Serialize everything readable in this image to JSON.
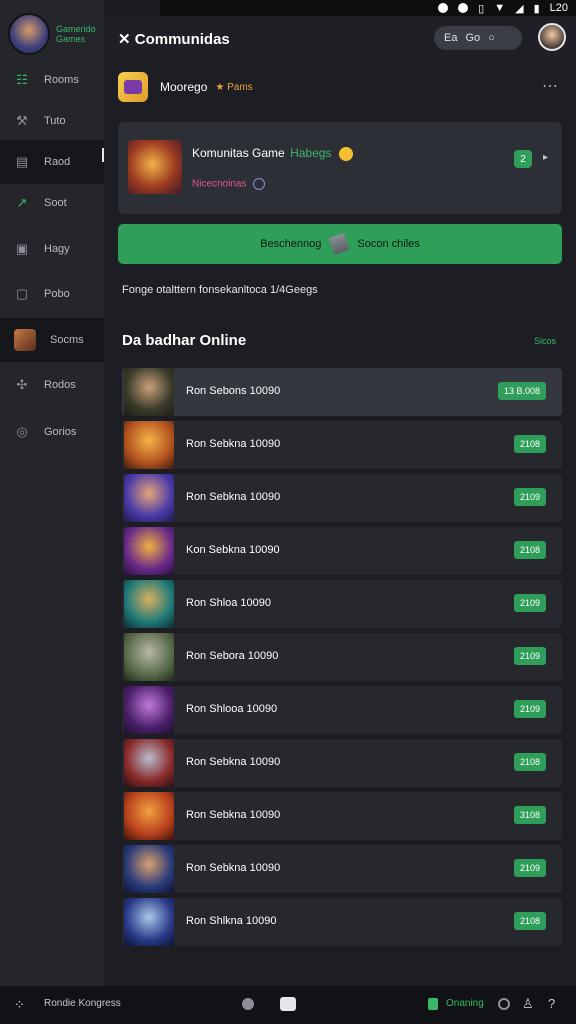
{
  "status_bar": {
    "time": "L20"
  },
  "brand": {
    "line1": "Gamerido",
    "line2": "Games"
  },
  "sidebar": {
    "items": [
      {
        "label": "Rooms",
        "icon": "grid-icon"
      },
      {
        "label": "Tuto",
        "icon": "wrench-icon"
      },
      {
        "label": "Raod",
        "icon": "folder-icon"
      },
      {
        "label": "Soot",
        "icon": "trend-icon"
      },
      {
        "label": "Hagy",
        "icon": "image-icon"
      },
      {
        "label": "Pobo",
        "icon": "box-icon"
      },
      {
        "label": "Socms",
        "icon": "avatar-badge"
      },
      {
        "label": "Rodos",
        "icon": "puzzle-icon"
      },
      {
        "label": "Gorios",
        "icon": "settings-icon"
      }
    ]
  },
  "header": {
    "title": "Communidas",
    "action1": "Ea",
    "action2": "Go"
  },
  "group": {
    "name": "Moorego",
    "tag": "Pams"
  },
  "community": {
    "title": "Komunitas Game",
    "title_suffix": "Habegs",
    "subtitle": "Nicecnoinas",
    "badge": "2"
  },
  "join": {
    "left": "Beschennog",
    "right": "Socon chiles"
  },
  "info": "Fonge otalttern fonsekanltoca 1/4Geegs",
  "online": {
    "title": "Da badhar Online",
    "link": "Sicos",
    "players": [
      {
        "label": "Ron Sebons 10090",
        "badge": "13 B.008"
      },
      {
        "label": "Ron Sebkna 10090",
        "badge": "2108"
      },
      {
        "label": "Ron Sebkna 10090",
        "badge": "2109"
      },
      {
        "label": "Kon Sebkna 10090",
        "badge": "2108"
      },
      {
        "label": "Ron Shloa 10090",
        "badge": "2109"
      },
      {
        "label": "Ron Sebora 10090",
        "badge": "2109"
      },
      {
        "label": "Ron Shlooa 10090",
        "badge": "2109"
      },
      {
        "label": "Ron Sebkna 10090",
        "badge": "2108"
      },
      {
        "label": "Ron Sebkna 10090",
        "badge": "3108"
      },
      {
        "label": "Ron Sebkna 10090",
        "badge": "2109"
      },
      {
        "label": "Ron Shlkna 10090",
        "badge": "2108"
      }
    ]
  },
  "bottom_bar": {
    "label": "Rondie Kongress",
    "status": "Onaning"
  }
}
